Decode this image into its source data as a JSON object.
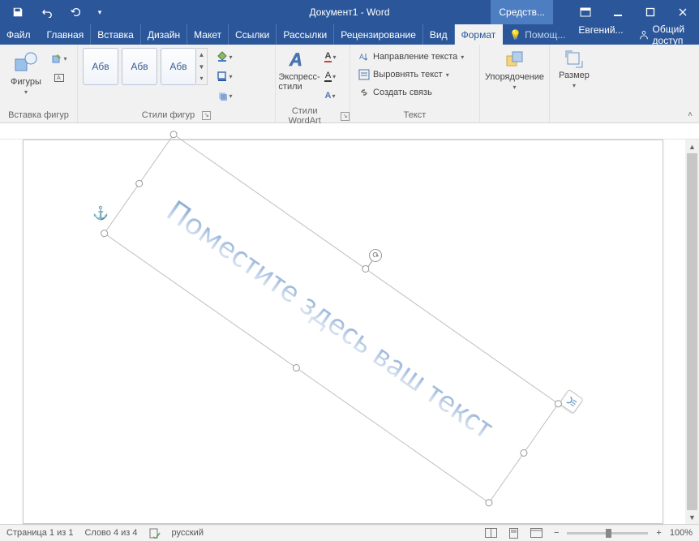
{
  "titlebar": {
    "title": "Документ1 - Word",
    "contextual": "Средств..."
  },
  "qat": {
    "customize": "▾"
  },
  "menu": {
    "file": "Файл",
    "tabs": [
      "Главная",
      "Вставка",
      "Дизайн",
      "Макет",
      "Ссылки",
      "Рассылки",
      "Рецензирование",
      "Вид",
      "Формат"
    ],
    "help": "Помощ...",
    "user": "Евгений...",
    "share": "Общий доступ"
  },
  "ribbon": {
    "shapes": {
      "label": "Фигуры",
      "group_label": "Вставка фигур"
    },
    "shape_styles": {
      "sample": "Абв",
      "group_label": "Стили фигур"
    },
    "wordart_styles": {
      "big_label": "Экспресс-\nстили",
      "group_label": "Стили WordArt"
    },
    "text": {
      "direction": "Направление текста",
      "align": "Выровнять текст",
      "create_link": "Создать связь",
      "group_label": "Текст"
    },
    "arrange": {
      "label": "Упорядочение"
    },
    "size": {
      "label": "Размер"
    }
  },
  "wordart": {
    "placeholder_text": "Поместите здесь ваш текст"
  },
  "statusbar": {
    "page": "Страница 1 из 1",
    "words": "Слово 4 из 4",
    "language": "русский",
    "zoom": "100%"
  }
}
